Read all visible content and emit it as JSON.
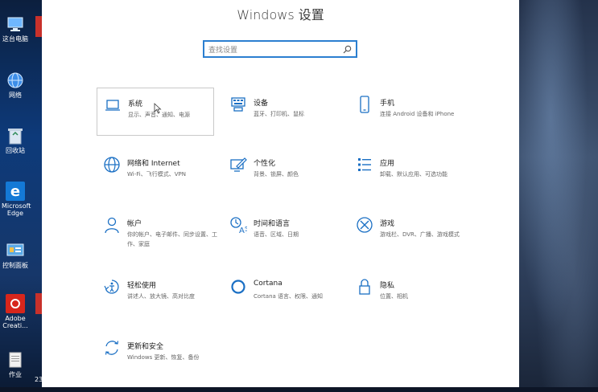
{
  "window": {
    "title": "Windows 设置"
  },
  "search": {
    "placeholder": "查找设置"
  },
  "desktop": {
    "icons": [
      {
        "label": "这台电脑",
        "icon": "computer-icon"
      },
      {
        "label": "网络",
        "icon": "network-icon"
      },
      {
        "label": "回收站",
        "icon": "recycle-bin-icon"
      },
      {
        "label": "Microsoft Edge",
        "icon": "edge-icon"
      },
      {
        "label": "控制面板",
        "icon": "control-panel-icon"
      },
      {
        "label": "Adobe Creati...",
        "icon": "adobe-icon"
      },
      {
        "label": "作业",
        "icon": "folder-icon"
      }
    ],
    "peek_label": "23"
  },
  "tiles": [
    {
      "name": "系统",
      "desc": "显示、声音、通知、电源",
      "icon": "laptop-icon"
    },
    {
      "name": "设备",
      "desc": "蓝牙、打印机、鼠标",
      "icon": "keyboard-icon"
    },
    {
      "name": "手机",
      "desc": "连接 Android 设备和 iPhone",
      "icon": "phone-icon"
    },
    {
      "name": "网络和 Internet",
      "desc": "Wi-Fi、飞行模式、VPN",
      "icon": "globe-icon"
    },
    {
      "name": "个性化",
      "desc": "背景、锁屏、颜色",
      "icon": "pen-screen-icon"
    },
    {
      "name": "应用",
      "desc": "卸载、默认应用、可选功能",
      "icon": "apps-list-icon"
    },
    {
      "name": "帐户",
      "desc": "你的帐户、电子邮件、同步设置、工作、家庭",
      "icon": "person-icon"
    },
    {
      "name": "时间和语言",
      "desc": "语音、区域、日期",
      "icon": "time-language-icon"
    },
    {
      "name": "游戏",
      "desc": "游戏栏、DVR、广播、游戏模式",
      "icon": "xbox-icon"
    },
    {
      "name": "轻松使用",
      "desc": "讲述人、放大镜、高对比度",
      "icon": "ease-of-access-icon"
    },
    {
      "name": "Cortana",
      "desc": "Cortana 语言、权限、通知",
      "icon": "cortana-icon"
    },
    {
      "name": "隐私",
      "desc": "位置、相机",
      "icon": "lock-icon"
    },
    {
      "name": "更新和安全",
      "desc": "Windows 更新、恢复、备份",
      "icon": "update-icon"
    }
  ],
  "colors": {
    "accent": "#1a6fc4",
    "search_border": "#2b7fd0"
  }
}
